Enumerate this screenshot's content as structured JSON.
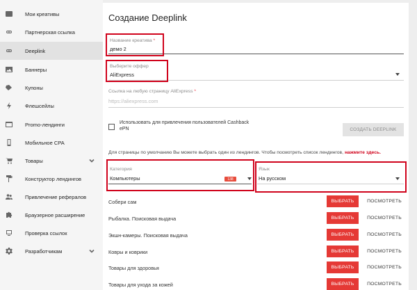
{
  "sidebar": {
    "items": [
      {
        "label": "Мои креативы",
        "icon": "creatives-icon"
      },
      {
        "label": "Партнерская ссылка",
        "icon": "link-icon"
      },
      {
        "label": "Deeplink",
        "icon": "link-icon"
      },
      {
        "label": "Баннеры",
        "icon": "image-icon"
      },
      {
        "label": "Купоны",
        "icon": "coupon-icon"
      },
      {
        "label": "Флешсейлы",
        "icon": "flash-icon"
      },
      {
        "label": "Promo-лендинги",
        "icon": "landing-icon"
      },
      {
        "label": "Мобильное CPA",
        "icon": "mobile-icon"
      },
      {
        "label": "Товары",
        "icon": "cart-icon"
      },
      {
        "label": "Конструктор лендингов",
        "icon": "paint-roller-icon"
      },
      {
        "label": "Привлечение рефералов",
        "icon": "referrals-icon"
      },
      {
        "label": "Браузерное расширение",
        "icon": "puzzle-icon"
      },
      {
        "label": "Проверка ссылок",
        "icon": "check-link-icon"
      },
      {
        "label": "Разработчикам",
        "icon": "gear-icon"
      }
    ],
    "active_index": 2
  },
  "main": {
    "title": "Создание Deeplink",
    "creative_name": {
      "label": "Название креатива",
      "required_mark": "*",
      "value": "демо 2"
    },
    "offer": {
      "label": "Выберите оффер",
      "value": "AliExpress"
    },
    "url": {
      "label": "Ссылка на любую страницу AliExpress",
      "required_mark": "*",
      "placeholder": "https://aliexpress.com"
    },
    "cashback_checkbox": {
      "label": "Использовать для привлечения пользователей Cashback ePN",
      "checked": false
    },
    "create_button": "СОЗДАТЬ DEEPLINK",
    "hint": {
      "text": "Для страницы по умолчанию Вы можете выбрать один из лендингов. Чтобы посмотреть список лендингов, ",
      "link": "нажмите здесь."
    },
    "category": {
      "label": "Категория",
      "value": "Компьютеры",
      "badge": "138"
    },
    "language": {
      "label": "Язык",
      "value": "На русском"
    },
    "landing_rows": [
      {
        "label": "Собери сам",
        "pick": "ВЫБРАТЬ",
        "view": "ПОСМОТРЕТЬ"
      },
      {
        "label": "Рыбалка. Поисковая выдача",
        "pick": "ВЫБРАТЬ",
        "view": "ПОСМОТРЕТЬ"
      },
      {
        "label": "Экшн-камеры. Поисковая выдача",
        "pick": "ВЫБРАТЬ",
        "view": "ПОСМОТРЕТЬ"
      },
      {
        "label": "Ковры и коврики",
        "pick": "ВЫБРАТЬ",
        "view": "ПОСМОТРЕТЬ"
      },
      {
        "label": "Товары для здоровья",
        "pick": "ВЫБРАТЬ",
        "view": "ПОСМОТРЕТЬ"
      },
      {
        "label": "Товары для ухода за кожей",
        "pick": "ВЫБРАТЬ",
        "view": "ПОСМОТРЕТЬ"
      }
    ]
  },
  "colors": {
    "accent": "#e53935",
    "highlight": "#d0021b",
    "sidebar_bg": "#f5f5f5",
    "active_bg": "#e2e2e2"
  }
}
